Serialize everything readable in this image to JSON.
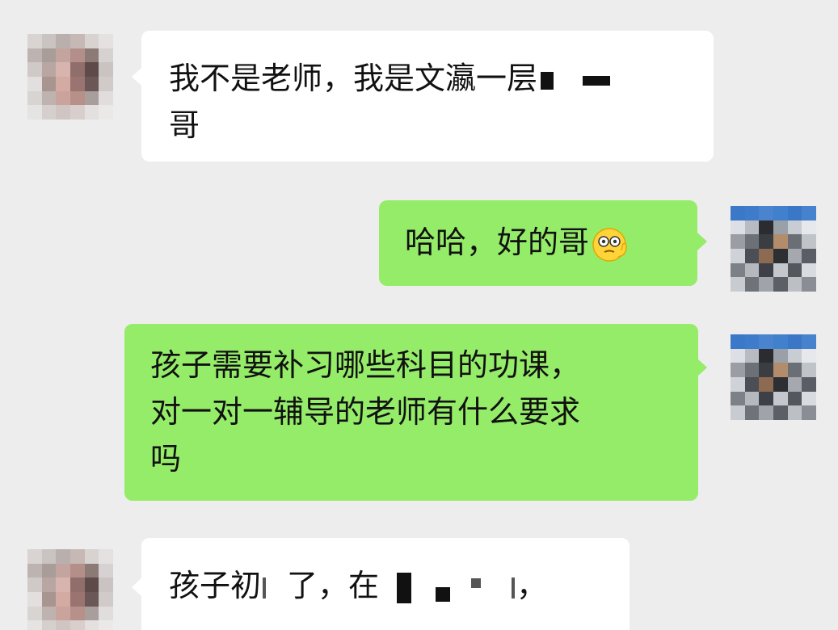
{
  "messages": [
    {
      "side": "left",
      "lines": [
        "我不是老师，我是文瀛一层",
        "哥"
      ]
    },
    {
      "side": "right",
      "lines": [
        "哈哈，好的哥"
      ],
      "emoji": "thinking-face-emoji"
    },
    {
      "side": "right",
      "lines": [
        "孩子需要补习哪些科目的功课，",
        "对一对一辅导的老师有什么要求",
        "吗"
      ]
    },
    {
      "side": "left",
      "segments": [
        "孩子初",
        "了，在",
        "，"
      ]
    }
  ],
  "colors": {
    "background": "#ededed",
    "incoming_bubble": "#ffffff",
    "outgoing_bubble": "#95ec69"
  }
}
